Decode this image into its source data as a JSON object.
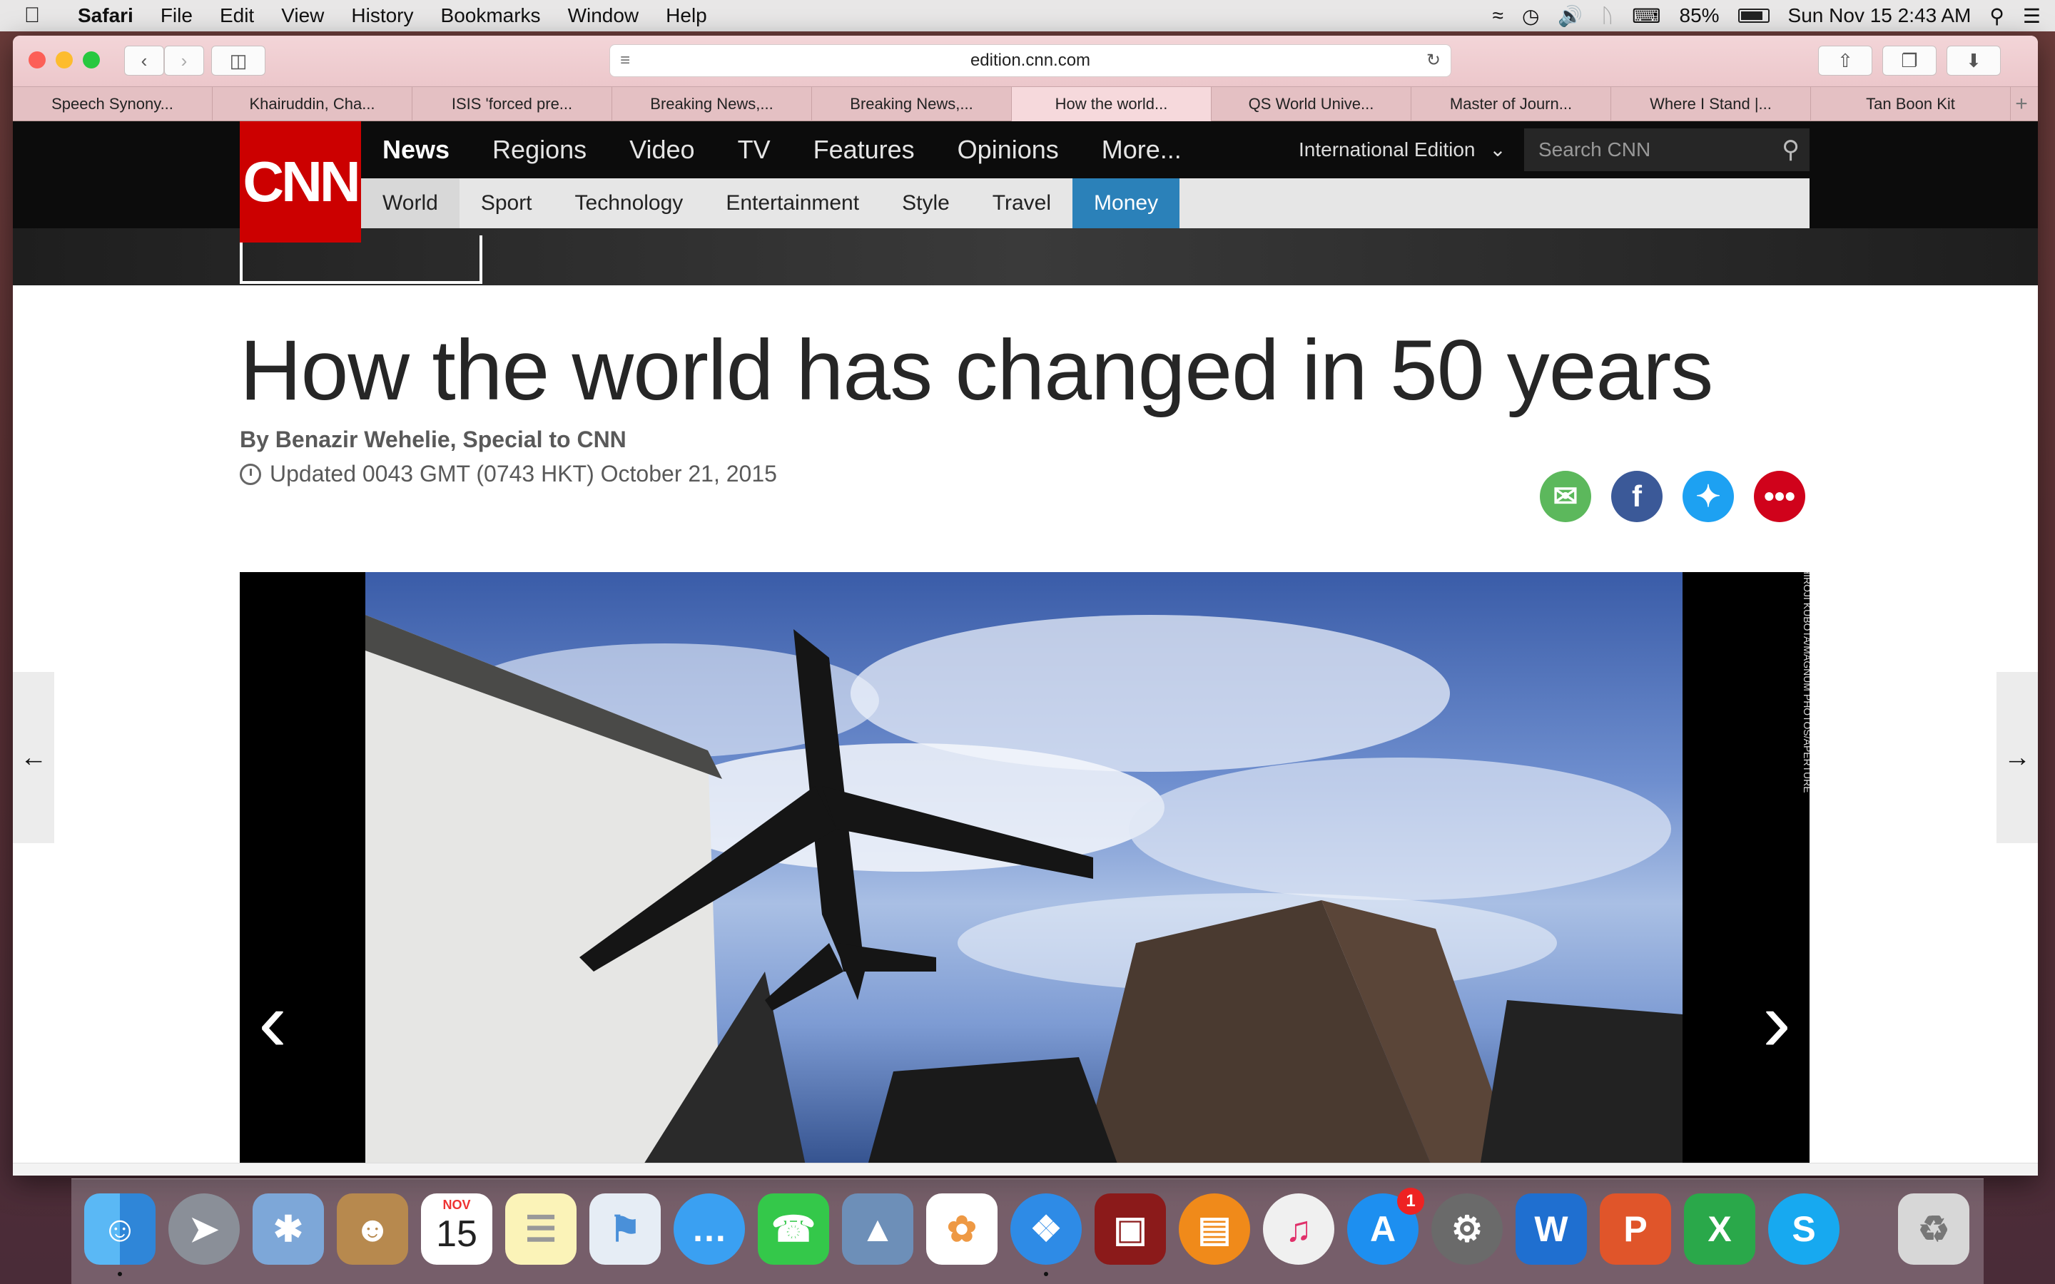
{
  "menubar": {
    "app": "Safari",
    "items": [
      "File",
      "Edit",
      "View",
      "History",
      "Bookmarks",
      "Window",
      "Help"
    ],
    "battery": "85%",
    "datetime": "Sun Nov 15  2:43 AM",
    "battery_level": 0.85
  },
  "browser": {
    "url": "edition.cnn.com",
    "tabs": [
      "Speech Synony...",
      "Khairuddin, Cha...",
      "ISIS 'forced pre...",
      "Breaking News,...",
      "Breaking News,...",
      "How the world...",
      "QS World Unive...",
      "Master of Journ...",
      "Where I Stand |...",
      "Tan Boon Kit"
    ],
    "active_tab_index": 5
  },
  "cnn": {
    "logo": "CNN",
    "nav": [
      "News",
      "Regions",
      "Video",
      "TV",
      "Features",
      "Opinions",
      "More..."
    ],
    "edition": "International Edition",
    "search_placeholder": "Search CNN",
    "subnav": [
      "World",
      "Sport",
      "Technology",
      "Entertainment",
      "Style",
      "Travel",
      "Money"
    ],
    "colors": {
      "red": "#cc0000",
      "money": "#2b81b9"
    }
  },
  "article": {
    "headline": "How the world has changed in 50 years",
    "byline": "By Benazir Wehelie, Special to CNN",
    "updated": "Updated 0043 GMT (0743 HKT) October 21, 2015",
    "photo_credit": "HIROJI KUBOTA/MAGNUM PHOTOS/APERTURE"
  },
  "share_icons": [
    "email-icon",
    "facebook-icon",
    "twitter-icon",
    "more-icon"
  ],
  "dock": {
    "calendar_month": "NOV",
    "calendar_day": "15",
    "app_store_badge": "1"
  }
}
